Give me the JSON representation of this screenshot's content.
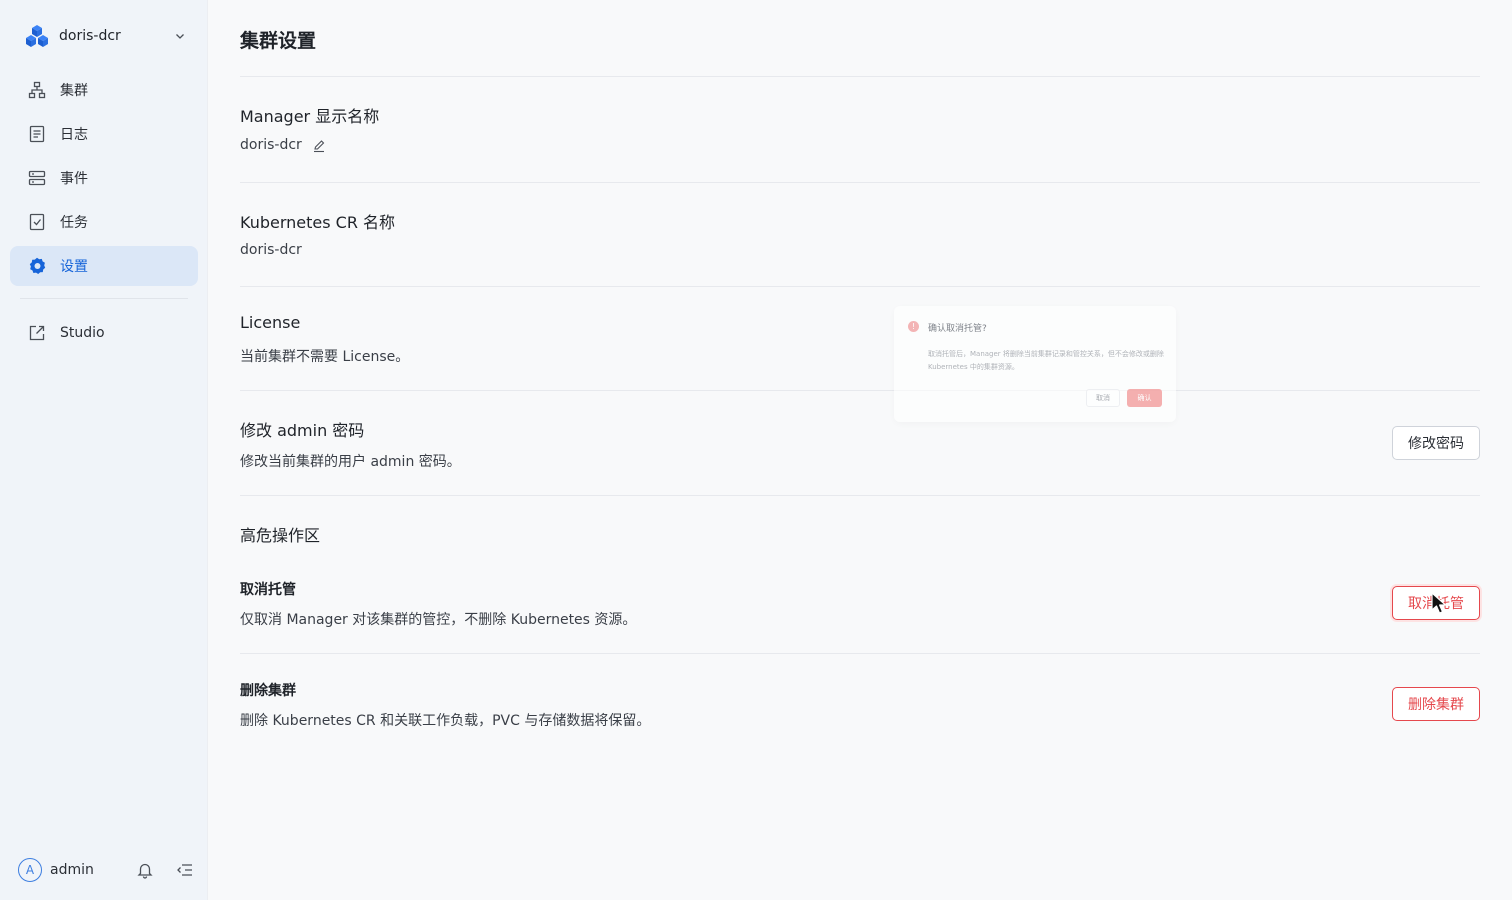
{
  "sidebar": {
    "workspace": "doris-dcr",
    "items": [
      {
        "label": "集群",
        "icon": "cluster-icon"
      },
      {
        "label": "日志",
        "icon": "log-icon"
      },
      {
        "label": "事件",
        "icon": "event-icon"
      },
      {
        "label": "任务",
        "icon": "task-icon"
      },
      {
        "label": "设置",
        "icon": "settings-gear-icon",
        "active": true
      }
    ],
    "external": {
      "label": "Studio",
      "icon": "external-link-icon"
    },
    "user": {
      "avatar_letter": "A",
      "name": "admin"
    }
  },
  "page": {
    "title": "集群设置",
    "manager_name": {
      "title": "Manager 显示名称",
      "value": "doris-dcr"
    },
    "cr_name": {
      "title": "Kubernetes CR 名称",
      "value": "doris-dcr"
    },
    "license": {
      "title": "License",
      "text": "当前集群不需要 License。"
    },
    "password": {
      "title": "修改 admin 密码",
      "text": "修改当前集群的用户 admin 密码。",
      "button": "修改密码"
    },
    "danger_zone": {
      "title": "高危操作区",
      "unmanage": {
        "title": "取消托管",
        "text": "仅取消 Manager 对该集群的管控，不删除 Kubernetes 资源。",
        "button": "取消托管"
      },
      "delete": {
        "title": "删除集群",
        "text": "删除 Kubernetes CR 和关联工作负载，PVC 与存储数据将保留。",
        "button": "删除集群"
      }
    }
  },
  "popconfirm": {
    "title": "确认取消托管?",
    "desc": "取消托管后，Manager 将删除当前集群记录和管控关系，但不会修改或删除 Kubernetes 中的集群资源。",
    "cancel": "取消",
    "ok": "确认"
  },
  "colors": {
    "accent": "#1664d9",
    "danger": "#e5484d",
    "sidebar_bg": "#f0f4f9",
    "active_bg": "#dbe7f7"
  }
}
